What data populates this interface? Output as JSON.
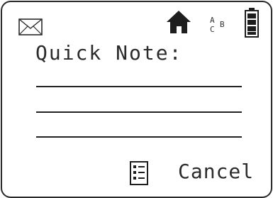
{
  "status_bar": {
    "left_icon": "mail-icon",
    "icons": [
      "home-icon",
      "abc-icon",
      "battery-icon"
    ],
    "abc_letters": {
      "a": "A",
      "b": "B",
      "c": "C"
    },
    "battery_level": 1.0
  },
  "note": {
    "title": "Quick Note:",
    "line_count": 3
  },
  "softkeys": {
    "menu_icon": "menu-list-icon",
    "cancel_label": "Cancel"
  },
  "colors": {
    "ink": "#222222",
    "background": "#ffffff"
  }
}
